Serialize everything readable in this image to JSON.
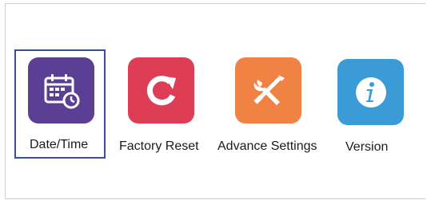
{
  "menu": {
    "items": [
      {
        "label": "Date/Time",
        "icon": "calendar-clock-icon",
        "color": "#5b3f95",
        "selected": true
      },
      {
        "label": "Factory Reset",
        "icon": "reset-arrow-icon",
        "color": "#dd3e55",
        "selected": false
      },
      {
        "label": "Advance Settings",
        "icon": "tools-icon",
        "color": "#f08343",
        "selected": false
      },
      {
        "label": "Version",
        "icon": "info-icon",
        "color": "#3b9bd6",
        "selected": false
      }
    ]
  }
}
